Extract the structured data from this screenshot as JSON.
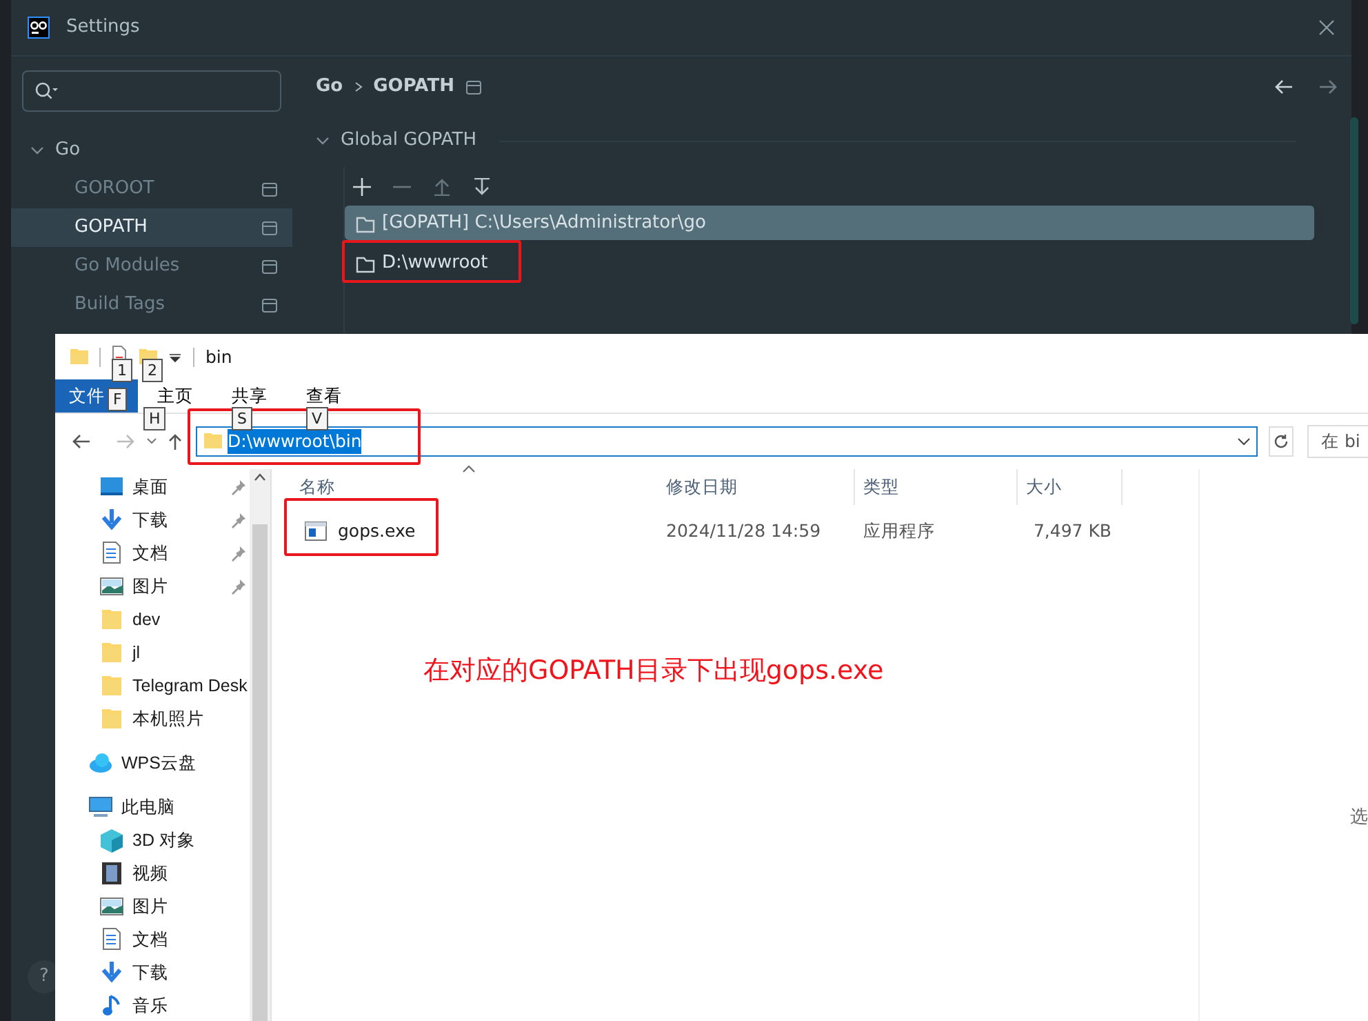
{
  "settings": {
    "title": "Settings",
    "tree": {
      "label": "Go",
      "expanded": true,
      "children": [
        {
          "label": "GOROOT",
          "selected": false
        },
        {
          "label": "GOPATH",
          "selected": true
        },
        {
          "label": "Go Modules",
          "selected": false
        },
        {
          "label": "Build Tags",
          "selected": false
        }
      ]
    },
    "breadcrumb": [
      "Go",
      "GOPATH"
    ],
    "section": {
      "label": "Global GOPATH",
      "expanded": true
    },
    "paths": [
      {
        "label": "[GOPATH] C:\\Users\\Administrator\\go",
        "selected": true,
        "highlighted": false
      },
      {
        "label": "D:\\wwwroot",
        "selected": false,
        "highlighted": true
      }
    ],
    "help_button": "?"
  },
  "explorer": {
    "title": "bin",
    "quick_access_keytips": [
      "1",
      "2"
    ],
    "ribbon_tabs": [
      {
        "label": "文件",
        "keytip": "F",
        "selected": true
      },
      {
        "label": "主页",
        "keytip": "H",
        "selected": false
      },
      {
        "label": "共享",
        "keytip": "S",
        "selected": false
      },
      {
        "label": "查看",
        "keytip": "V",
        "selected": false
      }
    ],
    "address": {
      "value": "D:\\wwwroot\\bin",
      "highlighted": true
    },
    "search_placeholder": "在 bi",
    "nav": [
      {
        "label": "桌面",
        "kind": "desktop",
        "pinned": true
      },
      {
        "label": "下载",
        "kind": "download",
        "pinned": true
      },
      {
        "label": "文档",
        "kind": "document",
        "pinned": true
      },
      {
        "label": "图片",
        "kind": "picture",
        "pinned": true
      },
      {
        "label": "dev",
        "kind": "folder",
        "pinned": false
      },
      {
        "label": "jl",
        "kind": "folder",
        "pinned": false
      },
      {
        "label": "Telegram Desk",
        "kind": "folder",
        "pinned": false
      },
      {
        "label": "本机照片",
        "kind": "folder",
        "pinned": false
      },
      {
        "label": "WPS云盘",
        "kind": "cloud",
        "pinned": false
      },
      {
        "label": "此电脑",
        "kind": "computer",
        "pinned": false
      },
      {
        "label": "3D 对象",
        "kind": "cube",
        "pinned": false
      },
      {
        "label": "视频",
        "kind": "video",
        "pinned": false
      },
      {
        "label": "图片",
        "kind": "picture",
        "pinned": false
      },
      {
        "label": "文档",
        "kind": "document",
        "pinned": false
      },
      {
        "label": "下载",
        "kind": "download",
        "pinned": false
      },
      {
        "label": "音乐",
        "kind": "music",
        "pinned": false
      }
    ],
    "columns": [
      "名称",
      "修改日期",
      "类型",
      "大小"
    ],
    "files": [
      {
        "name": "gops.exe",
        "modified": "2024/11/28 14:59",
        "type": "应用程序",
        "size": "7,497 KB",
        "highlighted": true
      }
    ],
    "details_hint": "选"
  },
  "annotation": {
    "text": "在对应的GOPATH目录下出现gops.exe"
  }
}
